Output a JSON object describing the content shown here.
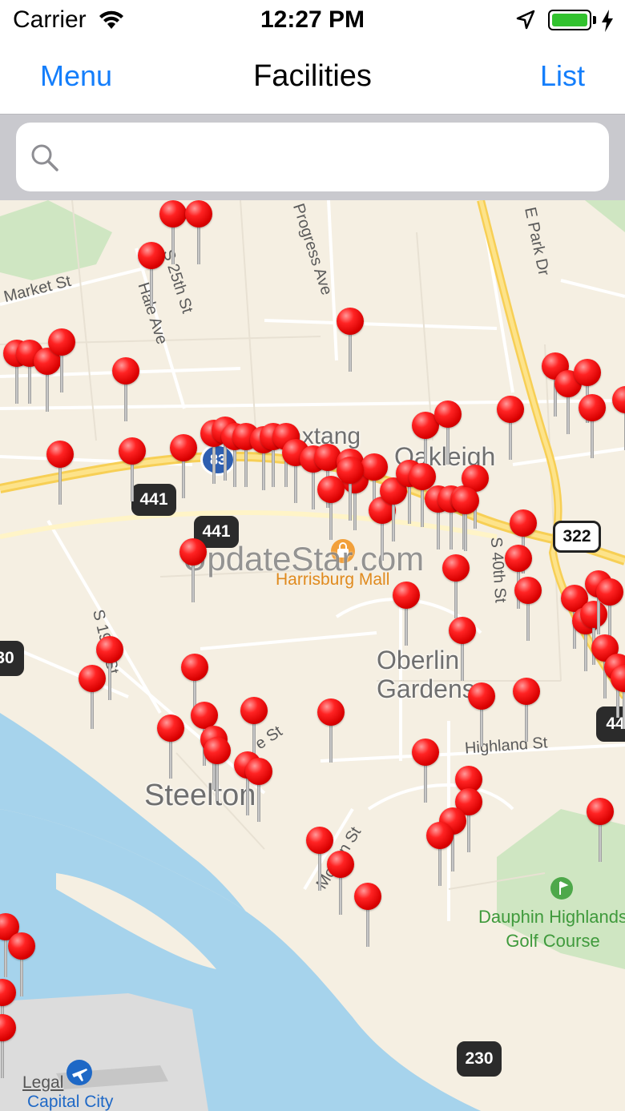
{
  "status_bar": {
    "carrier": "Carrier",
    "time": "12:27 PM",
    "battery_percent": 100
  },
  "nav": {
    "left": "Menu",
    "title": "Facilities",
    "right": "List"
  },
  "search": {
    "placeholder": "",
    "value": ""
  },
  "map": {
    "streets": {
      "market": "Market St",
      "hale": "Hale Ave",
      "s25": "S 25th St",
      "progress": "Progress Ave",
      "epark": "E Park Dr",
      "s19": "S 19th St",
      "s40": "S 40th St",
      "highland": "Highland St",
      "morton": "Morton St",
      "e_st": "e St"
    },
    "places": {
      "paxtang": "Paxtang",
      "oakleigh": "Oakleigh",
      "oberlin": "Oberlin Gardens",
      "steelton": "Steelton",
      "mall": "Harrisburg Mall",
      "golf": "Dauphin Highlands Golf Course",
      "legal": "Legal",
      "airport": "Capital City"
    },
    "shields": {
      "r441a": "441",
      "r441b": "441",
      "r83": "83",
      "r322": "322",
      "r230": "230",
      "r30": "30",
      "r44": "44"
    },
    "watermark": "UpdateStar.com"
  }
}
